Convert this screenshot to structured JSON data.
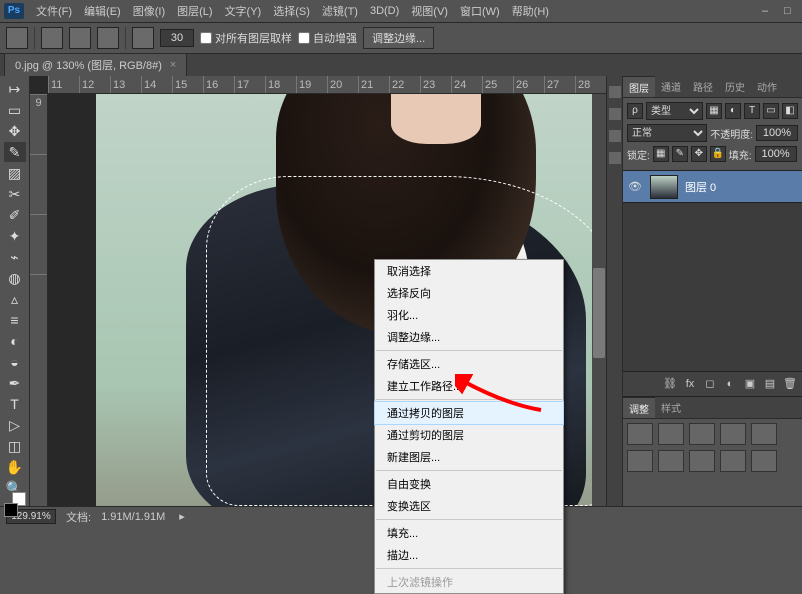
{
  "app": {
    "logo": "Ps"
  },
  "menubar": {
    "items": [
      "文件(F)",
      "编辑(E)",
      "图像(I)",
      "图层(L)",
      "文字(Y)",
      "选择(S)",
      "滤镜(T)",
      "3D(D)",
      "视图(V)",
      "窗口(W)",
      "帮助(H)"
    ]
  },
  "options": {
    "tolerance": "30",
    "all_layers_label": "对所有图层取样",
    "auto_enhance_label": "自动增强",
    "refine_btn": "调整边缘..."
  },
  "doc_tab": {
    "label": "0.jpg @ 130% (图层, RGB/8#)",
    "close": "×"
  },
  "ruler_h": [
    "11",
    "12",
    "13",
    "14",
    "15",
    "16",
    "17",
    "18",
    "19",
    "20",
    "21",
    "22",
    "23",
    "24",
    "25",
    "26",
    "27",
    "28"
  ],
  "ruler_v": [
    "9",
    "",
    "",
    "",
    "",
    ""
  ],
  "context_menu": {
    "items": [
      {
        "label": "取消选择",
        "dis": false
      },
      {
        "label": "选择反向",
        "dis": false
      },
      {
        "label": "羽化...",
        "dis": false
      },
      {
        "label": "调整边缘...",
        "dis": false
      },
      {
        "sep": true
      },
      {
        "label": "存储选区...",
        "dis": false
      },
      {
        "label": "建立工作路径...",
        "dis": false
      },
      {
        "sep": true
      },
      {
        "label": "通过拷贝的图层",
        "dis": false,
        "hl": true
      },
      {
        "label": "通过剪切的图层",
        "dis": false
      },
      {
        "label": "新建图层...",
        "dis": false
      },
      {
        "sep": true
      },
      {
        "label": "自由变换",
        "dis": false
      },
      {
        "label": "变换选区",
        "dis": false
      },
      {
        "sep": true
      },
      {
        "label": "填充...",
        "dis": false
      },
      {
        "label": "描边...",
        "dis": false
      },
      {
        "sep": true
      },
      {
        "label": "上次滤镜操作",
        "dis": true
      }
    ]
  },
  "right": {
    "panel_tabs": [
      "图层",
      "通道",
      "路径",
      "历史",
      "动作"
    ],
    "kind_label": "类型",
    "blend": "正常",
    "opacity_lbl": "不透明度:",
    "opacity_val": "100%",
    "lock_lbl": "锁定:",
    "fill_lbl": "填充:",
    "fill_val": "100%",
    "layer0": "图层 0",
    "adjust_tabs": [
      "调整",
      "样式"
    ]
  },
  "status": {
    "zoom": "129.91%",
    "doc_label": "文档:",
    "doc_size": "1.91M/1.91M"
  },
  "tools": [
    "↦",
    "▭",
    "✥",
    "✎",
    "▨",
    "✂",
    "✐",
    "✦",
    "⌁",
    "◍",
    "▵",
    "≡",
    "◐",
    "◒",
    "✒",
    "T",
    "▷",
    "◫",
    "✋",
    "🔍"
  ],
  "chart_data": null
}
